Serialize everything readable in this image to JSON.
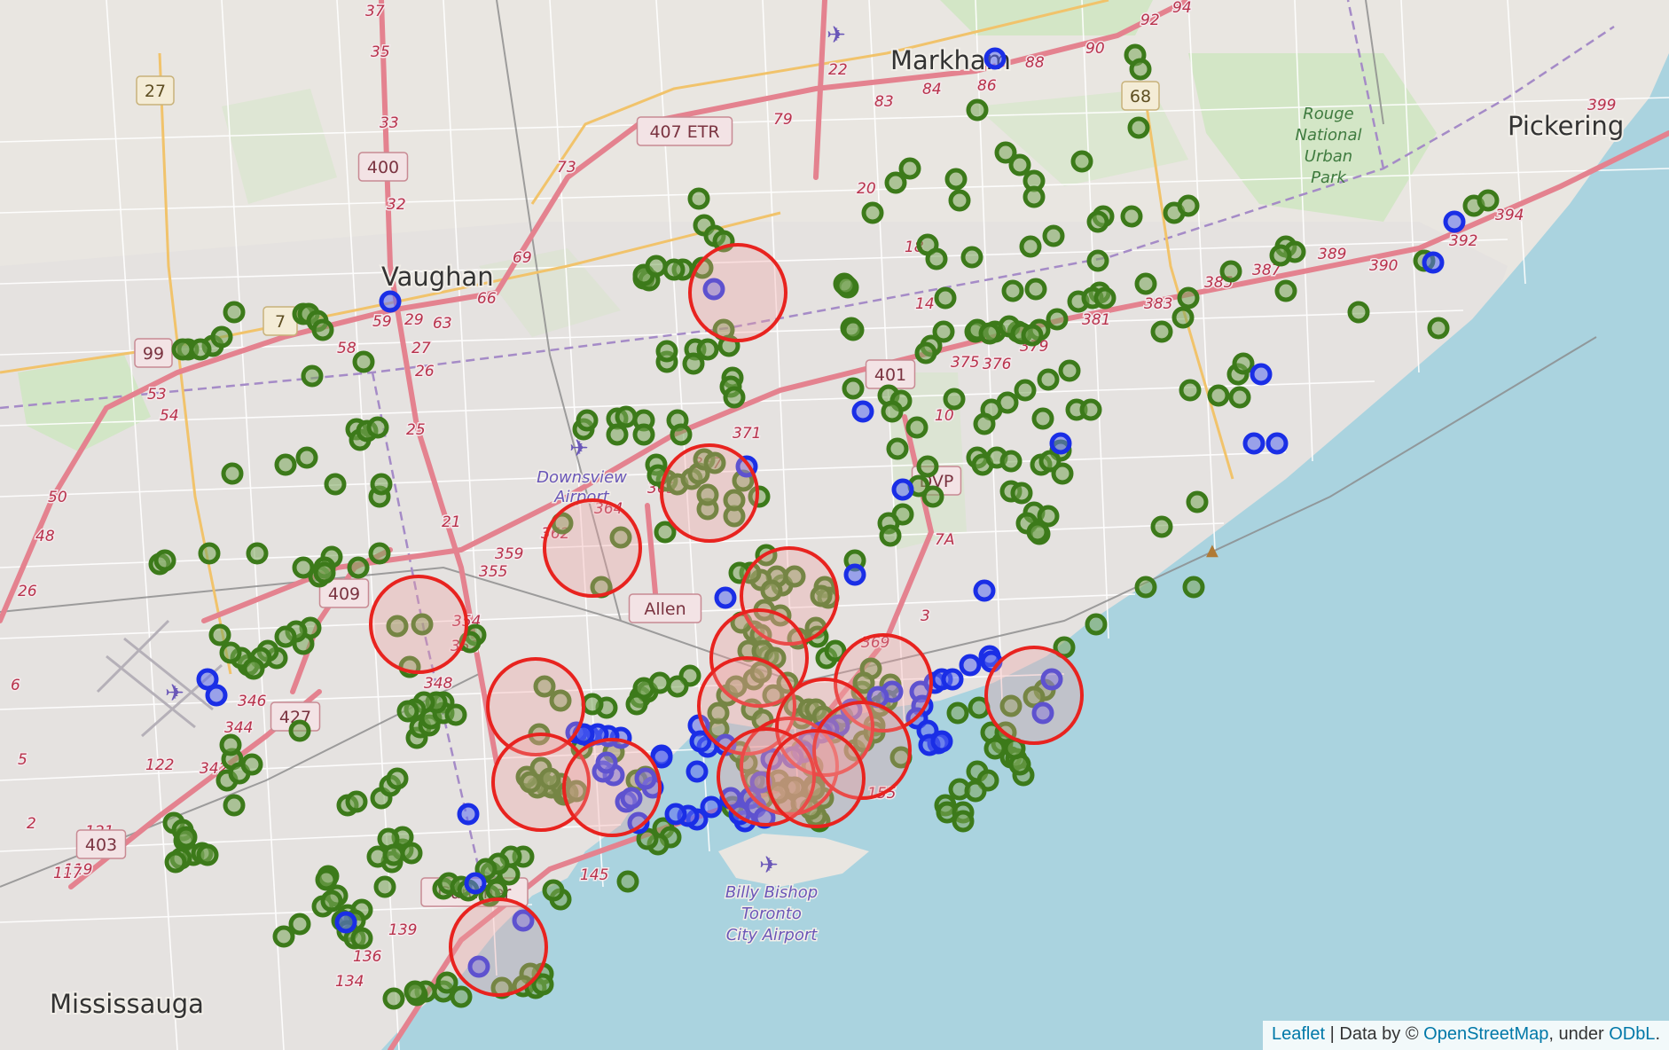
{
  "map": {
    "place_labels": [
      "Markham",
      "Vaughan",
      "Pickering",
      "Mississauga"
    ],
    "park_label_lines": [
      "Rouge",
      "National",
      "Urban",
      "Park"
    ],
    "airport_labels": {
      "downsview": [
        "Downsview",
        "Airport"
      ],
      "billy_bishop": [
        "Billy Bishop",
        "Toronto",
        "City Airport"
      ]
    },
    "highway_shields": [
      "407 ETR",
      "400",
      "401",
      "DVP",
      "409",
      "427",
      "403",
      "Allen",
      "Gardiner",
      "27",
      "7",
      "99",
      "68"
    ],
    "route_numbers": [
      "37",
      "35",
      "33",
      "32",
      "29",
      "27",
      "26",
      "25",
      "21",
      "92",
      "94",
      "90",
      "88",
      "86",
      "84",
      "83",
      "79",
      "73",
      "69",
      "66",
      "63",
      "59",
      "58",
      "54",
      "53",
      "50",
      "48",
      "26",
      "22",
      "20",
      "18",
      "14",
      "10",
      "7A",
      "3",
      "369",
      "371",
      "367",
      "365",
      "364",
      "362",
      "359",
      "355",
      "354",
      "352",
      "348",
      "346",
      "344",
      "342",
      "122",
      "121",
      "119",
      "117",
      "139",
      "136",
      "134",
      "145",
      "155",
      "375",
      "376",
      "379",
      "381",
      "383",
      "385",
      "387",
      "389",
      "390",
      "392",
      "394",
      "399",
      "2",
      "5",
      "6"
    ]
  },
  "colors": {
    "cluster_circle": "#e8231f",
    "cluster_fill": "#f0a0a0",
    "green_marker": "#3c7a1a",
    "blue_marker": "#1a2ee6",
    "water": "#aad3df"
  },
  "attribution": {
    "leaflet": "Leaflet",
    "sep": " | Data by © ",
    "osm": "OpenStreetMap",
    "under": ", under ",
    "odbl": "ODbL",
    "end": "."
  }
}
